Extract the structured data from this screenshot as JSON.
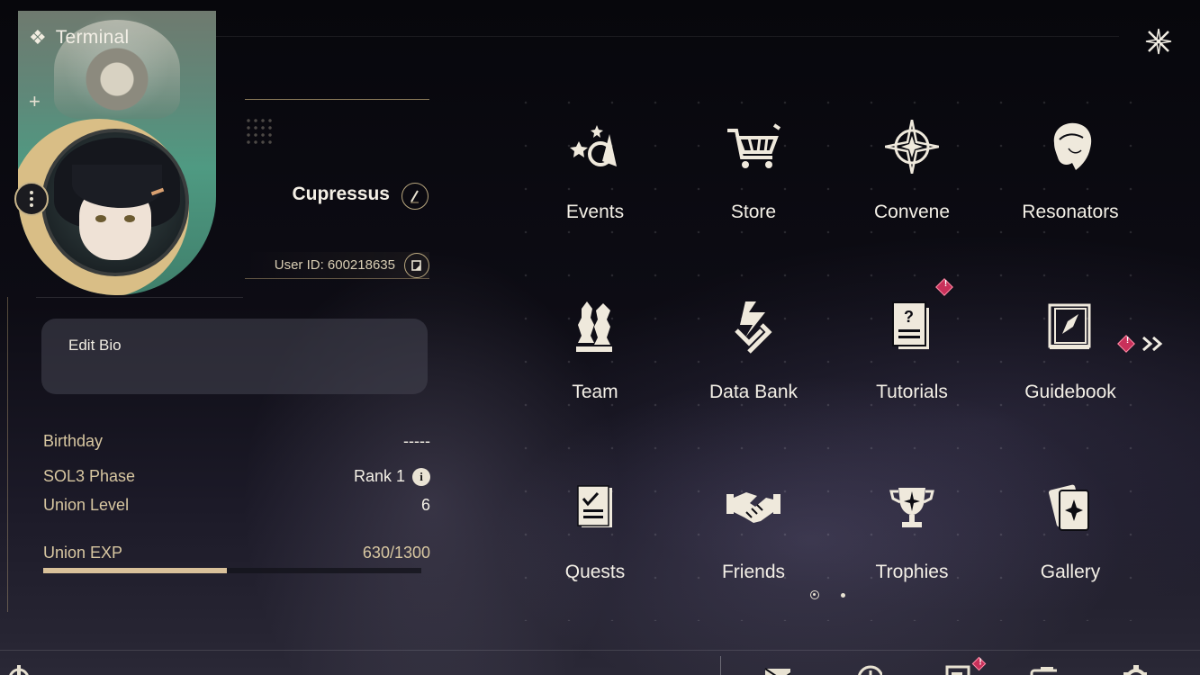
{
  "header": {
    "title": "Terminal"
  },
  "profile": {
    "name": "Cupressus",
    "user_id": "User ID: 600218635",
    "bio_label": "Edit Bio"
  },
  "stats": {
    "birthday_label": "Birthday",
    "birthday_value": "-----",
    "sol3_label": "SOL3 Phase",
    "sol3_value": "Rank 1",
    "union_level_label": "Union Level",
    "union_level_value": "6",
    "union_exp_label": "Union EXP",
    "union_exp_value": "630/1300",
    "union_exp_fraction": 0.485
  },
  "menu": [
    {
      "label": "Events",
      "icon": "events-icon",
      "badge": false
    },
    {
      "label": "Store",
      "icon": "store-cart-icon",
      "badge": false
    },
    {
      "label": "Convene",
      "icon": "convene-star-icon",
      "badge": false
    },
    {
      "label": "Resonators",
      "icon": "resonator-head-icon",
      "badge": false
    },
    {
      "label": "Team",
      "icon": "team-chess-icon",
      "badge": false
    },
    {
      "label": "Data Bank",
      "icon": "data-bank-icon",
      "badge": false
    },
    {
      "label": "Tutorials",
      "icon": "tutorials-book-icon",
      "badge": true
    },
    {
      "label": "Guidebook",
      "icon": "guidebook-compass-icon",
      "badge": false
    },
    {
      "label": "Quests",
      "icon": "quests-checklist-icon",
      "badge": false
    },
    {
      "label": "Friends",
      "icon": "friends-handshake-icon",
      "badge": false
    },
    {
      "label": "Trophies",
      "icon": "trophies-cup-icon",
      "badge": false
    },
    {
      "label": "Gallery",
      "icon": "gallery-cards-icon",
      "badge": false
    }
  ],
  "pager": {
    "pages": 2,
    "current": 1
  },
  "colors": {
    "accent_gold": "#d9c19a",
    "badge_red": "#c8305a",
    "text_light": "#f3efe6"
  }
}
